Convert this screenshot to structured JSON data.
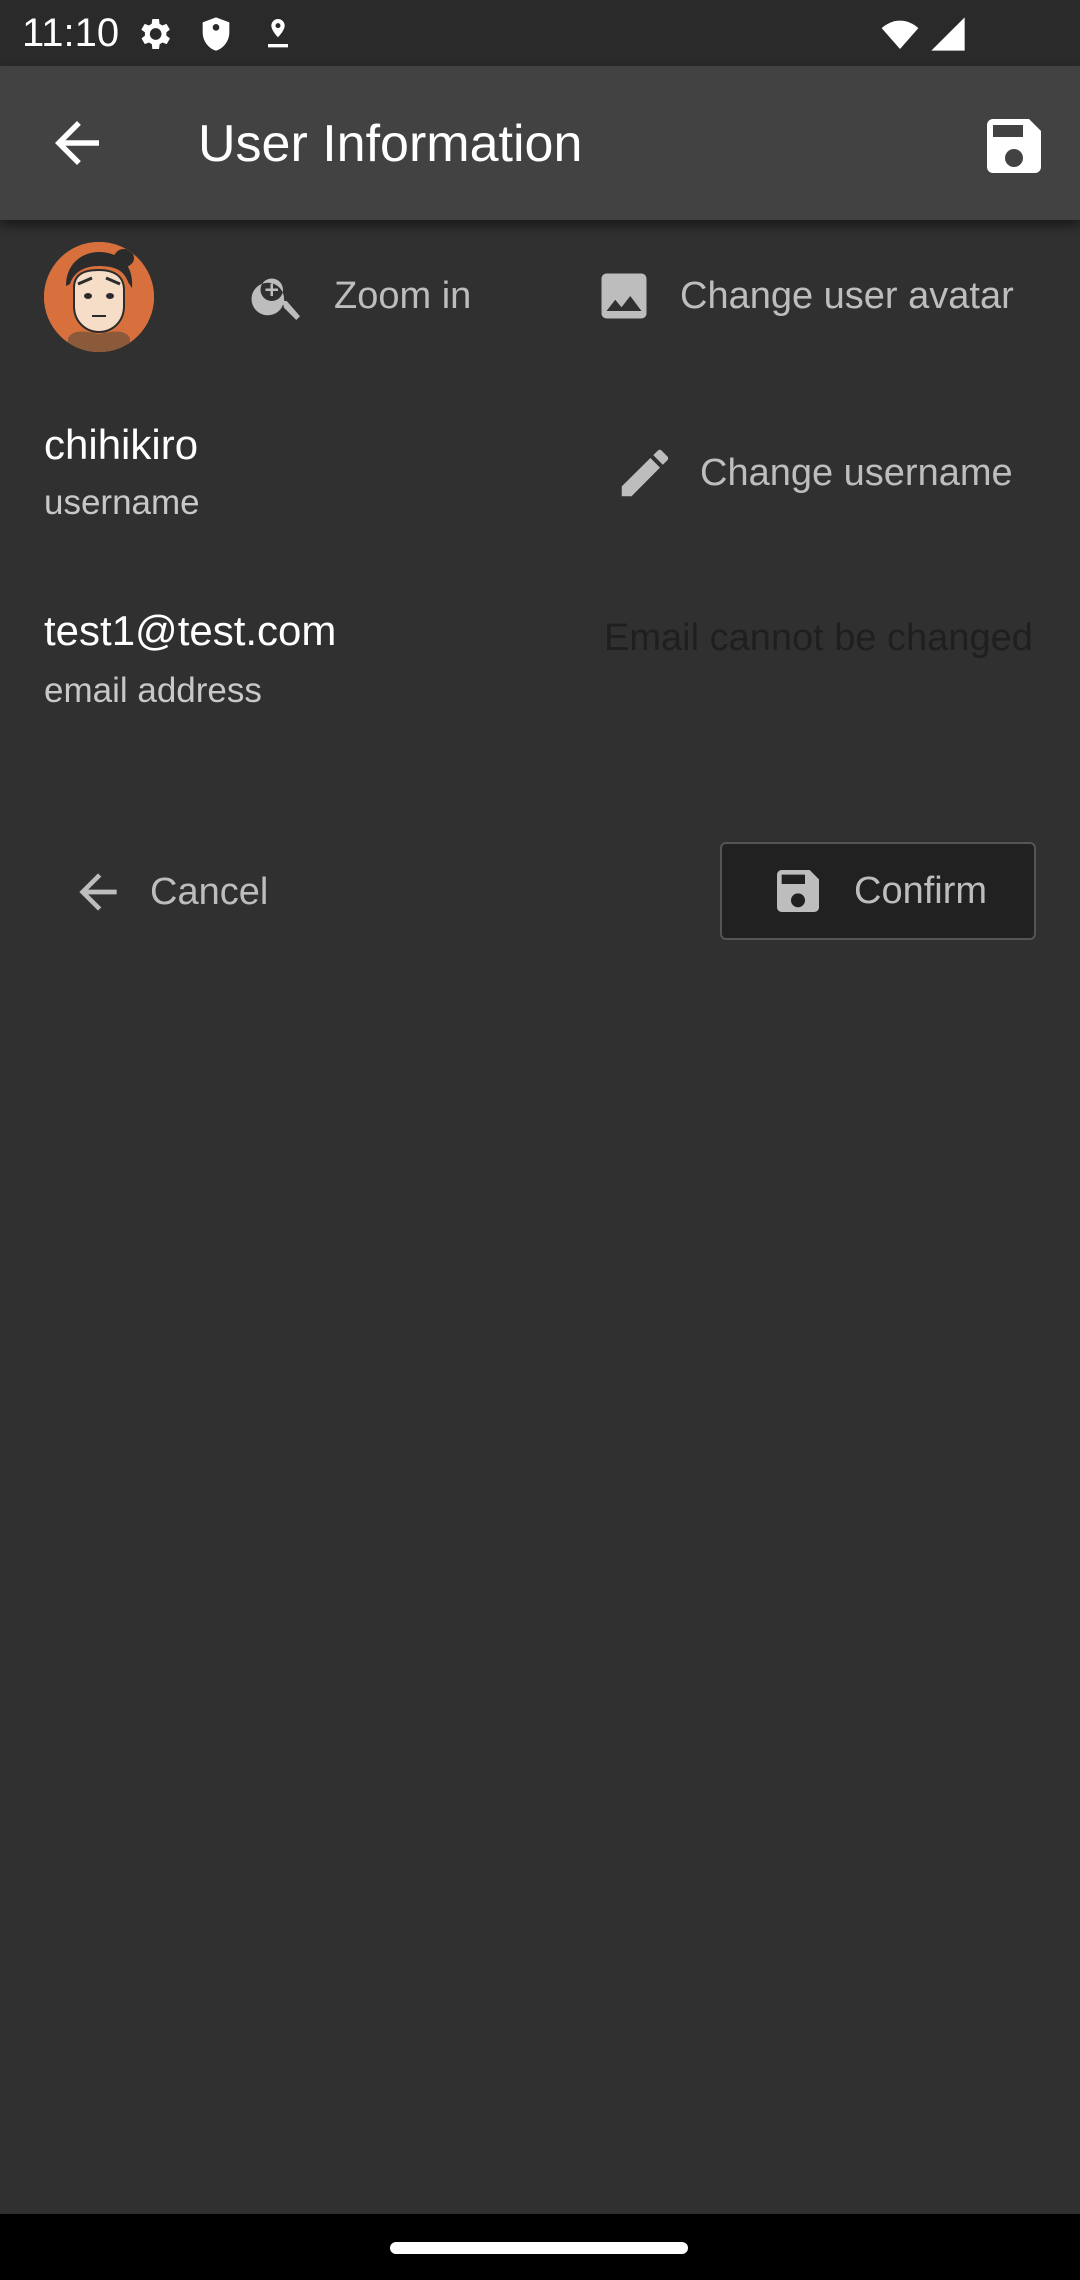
{
  "status_bar": {
    "time": "11:10",
    "icons": [
      "settings-gear-icon",
      "shield-icon",
      "location-icon",
      "wifi-icon",
      "cell-signal-icon"
    ]
  },
  "app_bar": {
    "title": "User Information",
    "back_icon": "arrow-back-icon",
    "save_icon": "save-icon"
  },
  "avatar_row": {
    "avatar_icon": "user-avatar",
    "zoom_label": "Zoom in",
    "zoom_icon": "zoom-in-icon",
    "change_avatar_label": "Change user avatar",
    "change_avatar_icon": "image-icon"
  },
  "username": {
    "value": "chihikiro",
    "label": "username",
    "change_label": "Change username",
    "change_icon": "pencil-icon"
  },
  "email": {
    "value": "test1@test.com",
    "label": "email address",
    "note": "Email cannot be changed"
  },
  "actions": {
    "cancel_label": "Cancel",
    "cancel_icon": "arrow-back-icon",
    "confirm_label": "Confirm",
    "confirm_icon": "save-icon"
  },
  "colors": {
    "background": "#303030",
    "app_bar": "#424242",
    "status_bar": "#2a2a2a",
    "muted_text": "#bdbdbd",
    "avatar_bg": "#d8703e"
  }
}
